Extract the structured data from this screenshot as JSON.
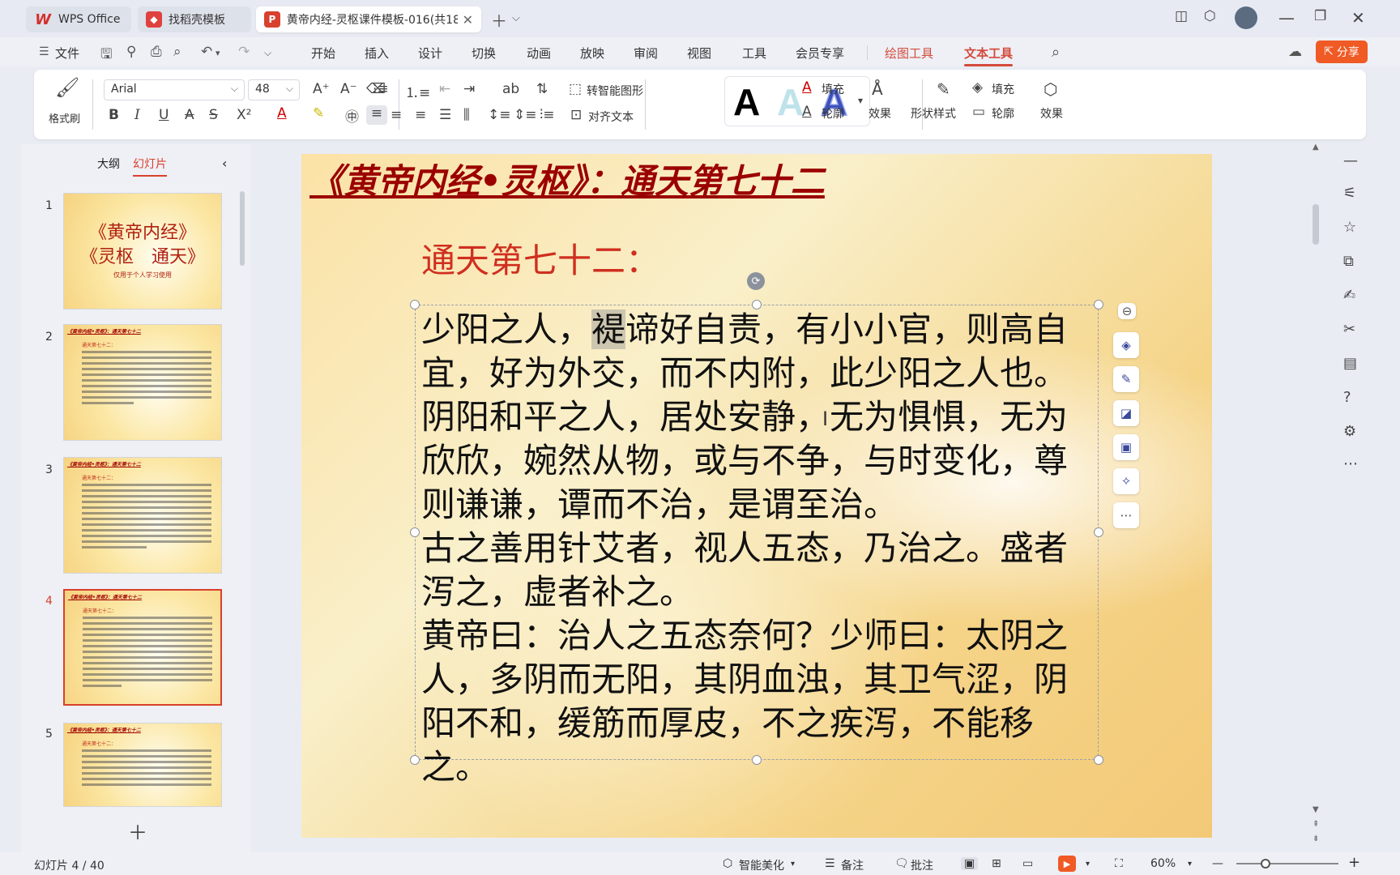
{
  "tabs": {
    "home": "WPS Office",
    "templates": "找稻壳模板",
    "active_doc": "黄帝内经-灵枢课件模板-016(共18"
  },
  "menu": {
    "file": "文件",
    "items": [
      "开始",
      "插入",
      "设计",
      "切换",
      "动画",
      "放映",
      "审阅",
      "视图",
      "工具",
      "会员专享"
    ],
    "context_drawing": "绘图工具",
    "context_text": "文本工具",
    "share": "分享"
  },
  "ribbon": {
    "format_painter": "格式刷",
    "font_name": "Arial",
    "font_size": "48",
    "smart_shape": "转智能图形",
    "align_text": "对齐文本",
    "text_fill": "填充",
    "text_outline": "轮廓",
    "text_effects": "效果",
    "shape_style": "形状样式",
    "shape_fill": "填充",
    "shape_outline": "轮廓",
    "shape_effects": "效果"
  },
  "left_panel": {
    "tab_outline": "大纲",
    "tab_slides": "幻灯片",
    "slide1": {
      "line1": "《黄帝内经》",
      "line2": "《灵枢　通天》",
      "note": "仅用于个人学习使用"
    },
    "slide_numbers": [
      "1",
      "2",
      "3",
      "4",
      "5"
    ],
    "thumb_title": "《黄帝内经•灵枢》：通天第七十二",
    "thumb_sub": "通天第七十二："
  },
  "slide": {
    "title": "《黄帝内经•灵枢》：通天第七十二",
    "subtitle": "通天第七十二：",
    "body_p1_highlight": "褆",
    "body_p1_before": "少阳之人，",
    "body_p1_after": "谛好自责，有小小官，则高自宜，好为外交，而不内附，此少阳之人也。",
    "body_p2": "阴阳和平之人，居处安静，无为惧惧，无为欣欣，婉然从物，或与不争，与时变化，尊则谦谦，谭而不治，是谓至治。",
    "body_p3": "古之善用针艾者，视人五态，乃治之。盛者泻之，虚者补之。",
    "body_p4": "黄帝曰：治人之五态奈何？少师曰：太阴之人，多阴而无阳，其阴血浊，其卫气涩，阴阳不和，缓筋而厚皮，不之疾泻，不能移之。"
  },
  "status": {
    "slide_counter": "幻灯片 4 / 40",
    "beautify": "智能美化",
    "notes": "备注",
    "comments": "批注",
    "zoom": "60%"
  },
  "colors": {
    "accent": "#d34b3b",
    "share_bg": "#f05a24",
    "slide_title": "#9b0000",
    "slide_subtitle": "#cf2f1f"
  }
}
